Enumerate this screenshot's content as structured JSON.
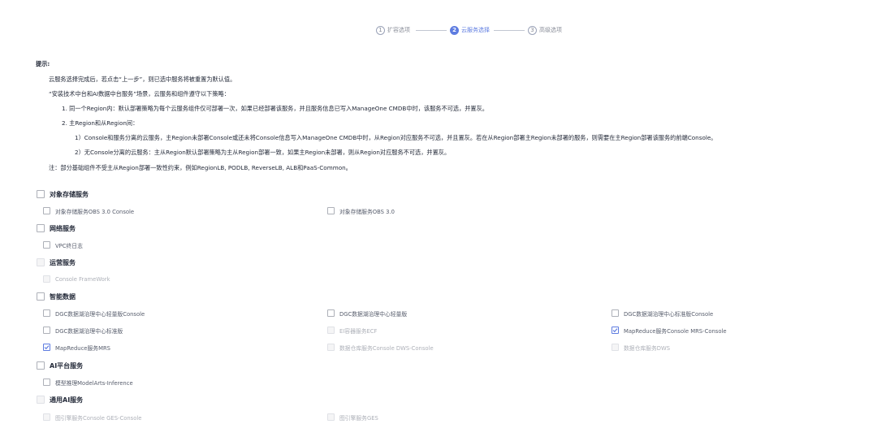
{
  "stepper": {
    "steps": [
      {
        "num": "1",
        "label": "扩容选项"
      },
      {
        "num": "2",
        "label": "云服务选择"
      },
      {
        "num": "3",
        "label": "高级选项"
      }
    ]
  },
  "tips": {
    "heading": "提示:",
    "line1": "云服务选择完成后，若点击“上一步”，则已选中服务将被重置为默认值。",
    "line2": "“安装技术中台和AI数据中台服务”场景，云服务和组件遵守以下策略：",
    "line3": "1. 同一个Region内：默认部署策略为每个云服务组件仅可部署一次，如果已经部署该服务，并且服务信息已写入ManageOne CMDB中时，该服务不可选，并置灰。",
    "line4": "2. 主Region和从Region间：",
    "line5": "1）Console和服务分离的云服务，主Region未部署Console或还未将Console信息写入ManageOne CMDB中时，从Region对应服务不可选，并且置灰。若在从Region部署主Region未部署的服务，则需要在主Region部署该服务的前端Console。",
    "line6": "2）无Console分离的云服务：主从Region默认部署策略为主从Region部署一致，如果主Region未部署，则从Region对应服务不可选，并置灰。",
    "line7": "注：部分基础组件不受主从Region部署一致性约束，例如RegionLB, PODLB, ReverseLB, ALB和PaaS-Common。"
  },
  "groups": {
    "object_storage": {
      "title": "对象存储服务",
      "items": [
        "对象存储服务OBS 3.0 Console",
        "对象存储服务OBS 3.0"
      ]
    },
    "network": {
      "title": "网络服务",
      "items": [
        "VPC终日志"
      ]
    },
    "ops": {
      "title": "运营服务",
      "items": [
        "Console FrameWork"
      ]
    },
    "smart_data": {
      "title": "智能数据",
      "items": [
        "DGC数据湖治理中心轻量版Console",
        "DGC数据湖治理中心轻量版",
        "DGC数据湖治理中心标准版Console",
        "DGC数据湖治理中心标准版",
        "EI容器服务ECF",
        "MapReduce服务Console MRS-Console",
        "MapReduce服务MRS",
        "数据仓库服务Console DWS-Console",
        "数据仓库服务DWS"
      ]
    },
    "ai_platform": {
      "title": "AI平台服务",
      "items": [
        "模型推理ModelArts-Inference"
      ]
    },
    "general_ai": {
      "title": "通用AI服务",
      "items": [
        "图引擎服务Console GES-Console",
        "图引擎服务GES"
      ]
    }
  },
  "colors": {
    "accent": "#5e7ce0",
    "text": "#252b3a",
    "muted": "#8a8e99",
    "disabled": "#adb0b8"
  }
}
